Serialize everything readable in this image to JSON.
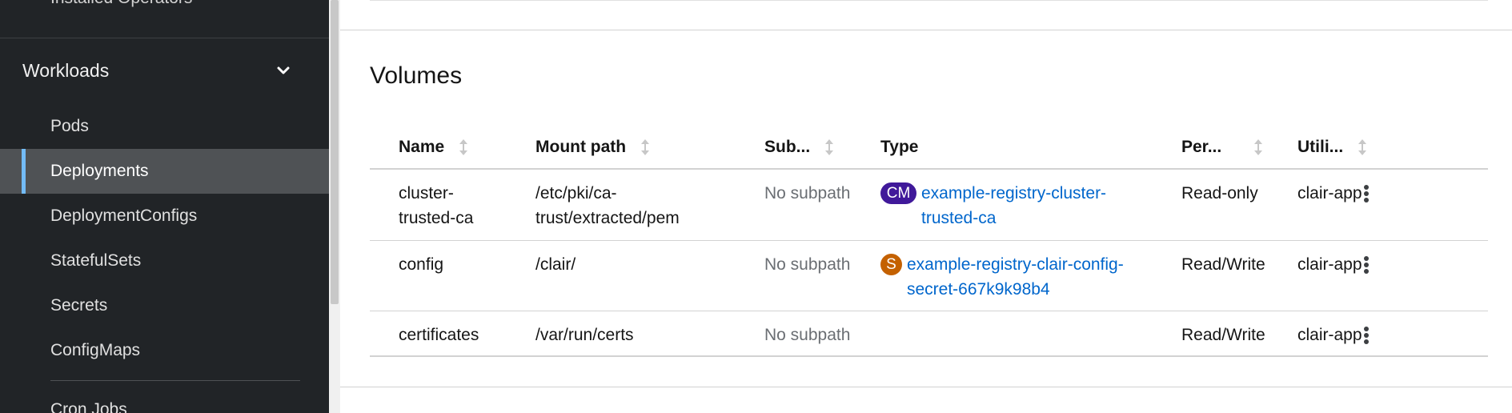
{
  "sidebar": {
    "top_item": "Installed Operators",
    "section": {
      "label": "Workloads",
      "icon": "chevron-down-icon"
    },
    "items": [
      {
        "label": "Pods",
        "active": false
      },
      {
        "label": "Deployments",
        "active": true
      },
      {
        "label": "DeploymentConfigs",
        "active": false
      },
      {
        "label": "StatefulSets",
        "active": false
      },
      {
        "label": "Secrets",
        "active": false
      },
      {
        "label": "ConfigMaps",
        "active": false
      }
    ],
    "bottom_item": "Cron Jobs"
  },
  "volumes": {
    "title": "Volumes",
    "columns": {
      "name": "Name",
      "mount_path": "Mount path",
      "subpath": "Sub...",
      "type": "Type",
      "permissions": "Per...",
      "utilized_by": "Utili..."
    },
    "rows": [
      {
        "name_line1": "cluster-",
        "name_line2": "trusted-ca",
        "mount_line1": "/etc/pki/ca-",
        "mount_line2": "trust/extracted/pem",
        "subpath": "No subpath",
        "type_badge": "CM",
        "type_link_line1": "example-registry-cluster-",
        "type_link_line2": "trusted-ca",
        "permissions": "Read-only",
        "utilized_by": "clair-app"
      },
      {
        "name": "config",
        "mount_path": "/clair/",
        "subpath": "No subpath",
        "type_badge": "S",
        "type_link_line1": "example-registry-clair-config-",
        "type_link_line2": "secret-667k9k98b4",
        "permissions": "Read/Write",
        "utilized_by": "clair-app"
      },
      {
        "name": "certificates",
        "mount_path": "/var/run/certs",
        "subpath": "No subpath",
        "permissions": "Read/Write",
        "utilized_by": "clair-app"
      }
    ]
  },
  "colors": {
    "sidebar_bg": "#212427",
    "active_bg": "#4f5255",
    "active_indicator": "#73bcf7",
    "link": "#0066cc",
    "badge_cm": "#40199a",
    "badge_s": "#c46100"
  }
}
